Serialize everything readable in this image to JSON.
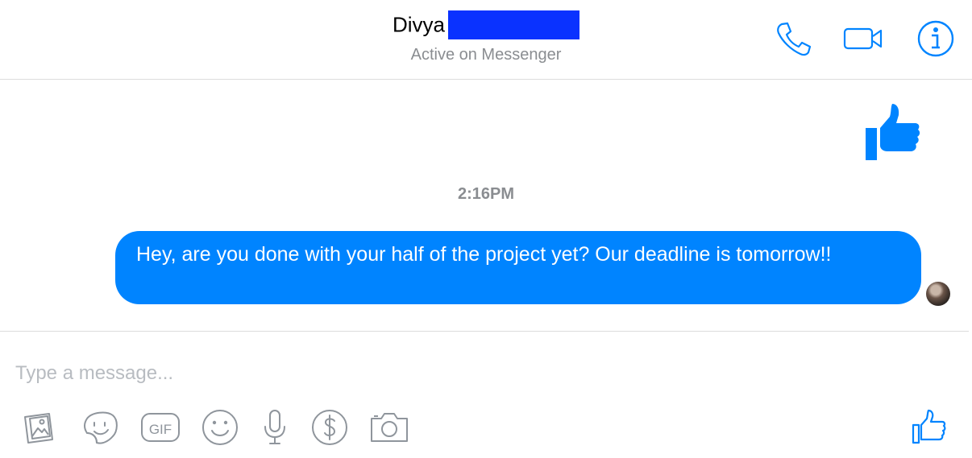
{
  "header": {
    "contact_name": "Divya",
    "status": "Active on Messenger",
    "actions": [
      "phone-icon",
      "video-camera-icon",
      "info-icon"
    ]
  },
  "thread": {
    "sent_reaction": "thumbs-up-icon",
    "timestamp": "2:16PM",
    "messages": [
      {
        "direction": "outgoing",
        "text": "Hey, are you done with your half of the project yet? Our deadline is tomorrow!!"
      }
    ],
    "seen_indicator": "avatar"
  },
  "composer": {
    "placeholder": "Type a message...",
    "value": "",
    "gif_label": "GIF",
    "tools": [
      "photo-icon",
      "sticker-icon",
      "gif-icon",
      "emoji-icon",
      "microphone-icon",
      "payment-icon",
      "camera-icon"
    ],
    "send_like": "thumbs-up-icon"
  },
  "colors": {
    "accent": "#0084ff",
    "redaction": "#0a32ff",
    "muted_text": "#8a8d91",
    "toolbar_icon": "#8f959c",
    "divider": "#dcdcdc"
  }
}
